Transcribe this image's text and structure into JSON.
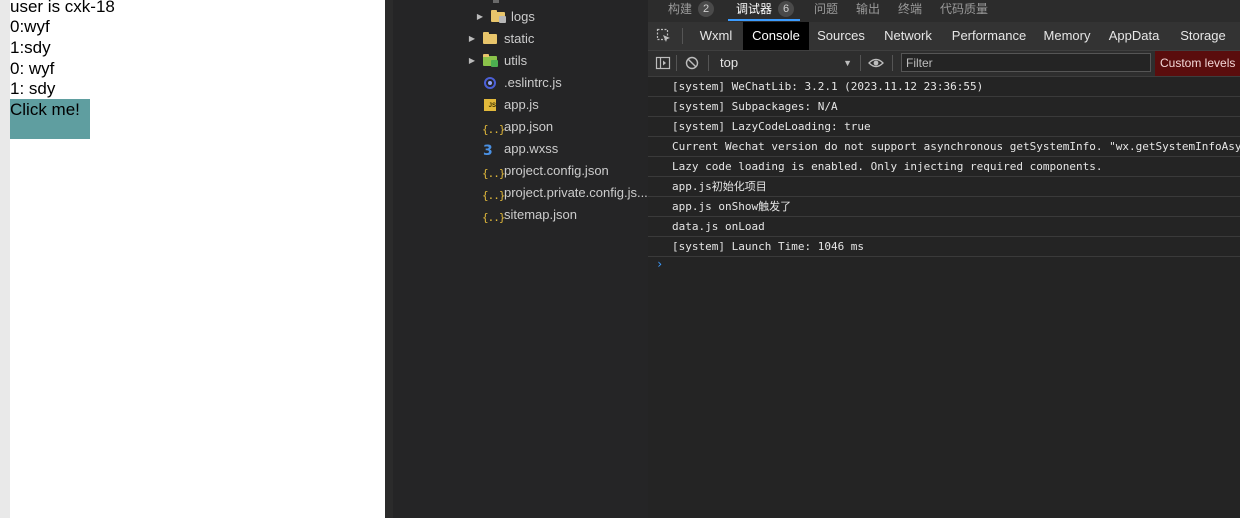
{
  "simulator": {
    "lines": [
      "user is cxk-18",
      "0:wyf",
      "1:sdy",
      "0: wyf",
      "1: sdy"
    ],
    "button_label": "Click me!"
  },
  "explorer": {
    "items": [
      {
        "label": "logs",
        "icon": "folder-icon",
        "expandable": true
      },
      {
        "label": "static",
        "icon": "folder-icon",
        "expandable": true
      },
      {
        "label": "utils",
        "icon": "folder-icon",
        "expandable": true
      },
      {
        "label": ".eslintrc.js",
        "icon": "eslint-icon",
        "expandable": false
      },
      {
        "label": "app.js",
        "icon": "js-file-icon",
        "expandable": false
      },
      {
        "label": "app.json",
        "icon": "json-file-icon",
        "expandable": false
      },
      {
        "label": "app.wxss",
        "icon": "css-file-icon",
        "expandable": false
      },
      {
        "label": "project.config.json",
        "icon": "json-file-icon",
        "expandable": false
      },
      {
        "label": "project.private.config.js...",
        "icon": "json-file-icon",
        "expandable": false
      },
      {
        "label": "sitemap.json",
        "icon": "json-file-icon",
        "expandable": false
      }
    ]
  },
  "devtools": {
    "top_tabs": [
      {
        "label": "构建",
        "badge": "2"
      },
      {
        "label": "调试器",
        "badge": "6"
      },
      {
        "label": "问题"
      },
      {
        "label": "输出"
      },
      {
        "label": "终端"
      },
      {
        "label": "代码质量"
      }
    ],
    "panel_tabs": [
      "Wxml",
      "Console",
      "Sources",
      "Network",
      "Performance",
      "Memory",
      "AppData",
      "Storage"
    ],
    "active_panel": "Console",
    "toolbar": {
      "context": "top",
      "filter_placeholder": "Filter",
      "levels_label": "Custom levels ▼"
    },
    "console_lines": [
      "[system] WeChatLib: 3.2.1 (2023.11.12 23:36:55)",
      "[system] Subpackages: N/A",
      "[system] LazyCodeLoading: true",
      "Current Wechat version do not support asynchronous getSystemInfo. \"wx.getSystemInfoAsy",
      "Lazy code loading is enabled. Only injecting required components.",
      "app.js初始化项目",
      "app.js onShow触发了",
      "data.js onLoad",
      "[system] Launch Time: 1046 ms"
    ],
    "prompt": "›"
  },
  "colors": {
    "accent": "#3c9cff",
    "button_bg": "#5f9ea0",
    "levels_bg": "#5a0d0d"
  }
}
